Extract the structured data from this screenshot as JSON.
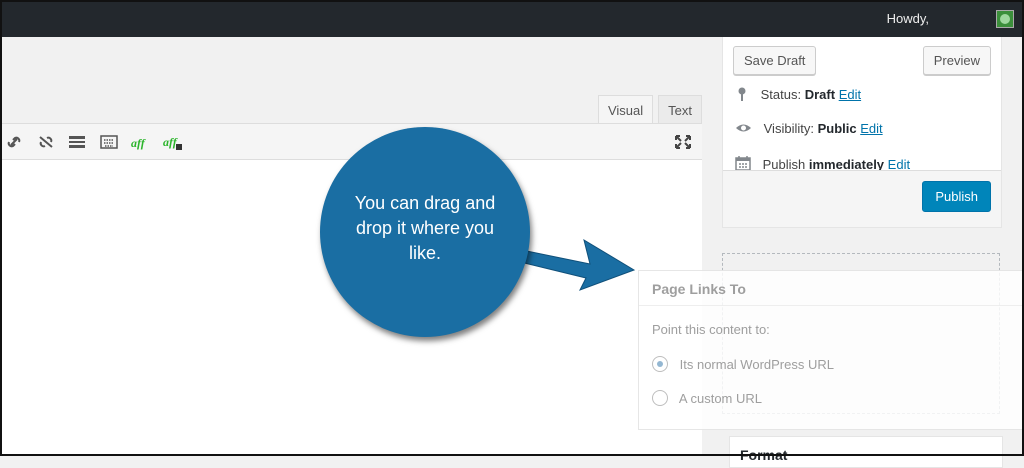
{
  "admin_bar": {
    "greeting": "Howdy,"
  },
  "editor": {
    "tabs": [
      {
        "label": "Visual"
      },
      {
        "label": "Text"
      }
    ],
    "toolbar_icons": [
      "link-icon",
      "unlink-icon",
      "insert-more-icon",
      "keyboard-shortcuts-icon",
      "aff-icon",
      "aff-add-icon",
      "fullscreen-icon"
    ]
  },
  "publish": {
    "save_draft": "Save Draft",
    "preview": "Preview",
    "status_label": "Status:",
    "status_value": "Draft",
    "visibility_label": "Visibility:",
    "visibility_value": "Public",
    "publish_label": "Publish",
    "publish_value": "immediately",
    "edit": "Edit",
    "publish_button": "Publish"
  },
  "page_links": {
    "title": "Page Links To",
    "prompt": "Point this content to:",
    "options": [
      {
        "label": "Its normal WordPress URL",
        "checked": true
      },
      {
        "label": "A custom URL",
        "checked": false
      }
    ]
  },
  "format_box": {
    "title": "Format"
  },
  "callout": {
    "text": "You can drag and drop it where you like."
  },
  "colors": {
    "accent": "#0085ba",
    "callout": "#1a6ea3",
    "admin_bar": "#23282d"
  }
}
